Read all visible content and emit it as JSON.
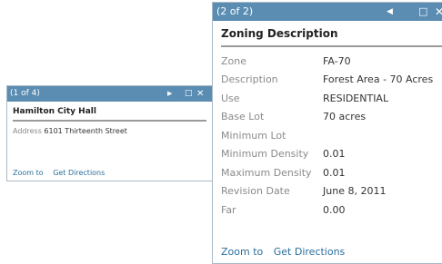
{
  "popup_small": {
    "counter": "(1 of 4)",
    "next_icon": "▶",
    "max_icon": "□",
    "close_icon": "✕",
    "title": "Hamilton City Hall",
    "address_label": "Address",
    "address_value": "6101 Thirteenth Street",
    "zoom_to": "Zoom to",
    "get_directions": "Get Directions"
  },
  "popup_large": {
    "counter": "(2 of 2)",
    "prev_icon": "◀",
    "max_icon": "□",
    "close_icon": "✕",
    "title": "Zoning Description",
    "fields": [
      {
        "label": "Zone",
        "value": "FA-70"
      },
      {
        "label": "Description",
        "value": "Forest Area - 70 Acres"
      },
      {
        "label": "Use",
        "value": "RESIDENTIAL"
      },
      {
        "label": "Base Lot",
        "value": "70 acres"
      },
      {
        "label": "Minimum Lot",
        "value": ""
      },
      {
        "label": "Minimum Density",
        "value": "0.01"
      },
      {
        "label": "Maximum Density",
        "value": "0.01"
      },
      {
        "label": "Revision Date",
        "value": "June 8, 2011"
      },
      {
        "label": "Far",
        "value": "0.00"
      }
    ],
    "zoom_to": "Zoom to",
    "get_directions": "Get Directions"
  },
  "colors": {
    "titlebar": "#5b8db3",
    "link": "#2a6f9e",
    "label": "#8a8a8a"
  }
}
